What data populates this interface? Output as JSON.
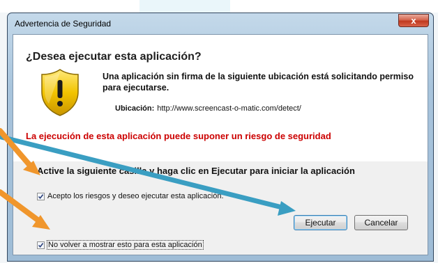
{
  "dialog": {
    "title": "Advertencia de Seguridad",
    "close_label": "x",
    "heading": "¿Desea ejecutar esta aplicación?",
    "message": "Una aplicación sin firma de la siguiente ubicación está solicitando permiso para ejecutarse.",
    "location_label": "Ubicación:",
    "location_value": "http://www.screencast-o-matic.com/detect/",
    "warning": "La ejecución de esta aplicación puede suponer un riesgo de seguridad",
    "instruction": "Active la siguiente casilla y haga clic en Ejecutar para iniciar la aplicación",
    "accept_risks_checkbox": {
      "label": "Acepto los riesgos y deseo ejecutar esta aplicación.",
      "checked": true
    },
    "dont_show_again_checkbox": {
      "label": "No volver a mostrar esto para esta aplicación",
      "checked": true
    },
    "run_button": "Ejecutar",
    "cancel_button": "Cancelar"
  },
  "colors": {
    "warning_text": "#cc0000",
    "arrow_blue": "#3a9ec2",
    "arrow_orange": "#f0962c",
    "shield_yellow": "#f2c400"
  },
  "icons": {
    "shield": "shield-warning-icon",
    "close": "close-icon",
    "arrow_blue": "arrow-annotation-blue",
    "arrow_orange": "arrow-annotation-orange"
  }
}
